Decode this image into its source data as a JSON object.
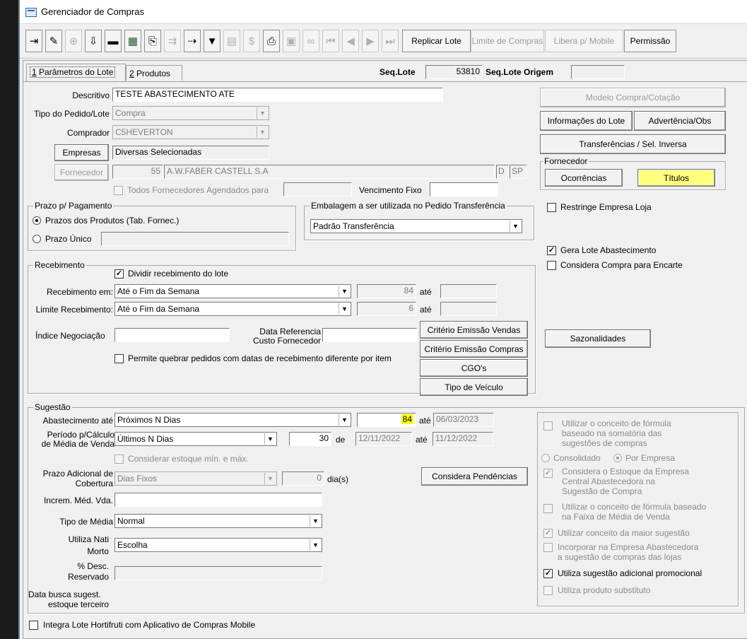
{
  "window": {
    "title": "Gerenciador de Compras"
  },
  "toolbar": {
    "icons": [
      "exit-icon",
      "edit-icon",
      "add-icon",
      "download-icon",
      "delete-icon",
      "grid-icon",
      "copy-icon",
      "transfer-icon",
      "next-step-icon",
      "filter-icon",
      "print-preview-icon",
      "money-icon",
      "print-icon",
      "clipboard-icon",
      "binoculars-icon",
      "first-record-icon",
      "previous-record-icon",
      "next-record-icon",
      "last-record-icon"
    ],
    "replicar_lote": "Replicar Lote",
    "limite_compras": "Limite de Compras",
    "libera_mobile": "Libera p/ Mobile",
    "permissao": "Permissão"
  },
  "tabs": {
    "tab1_num": "1",
    "tab1_label": "Parâmetros do Lote",
    "tab2_num": "2",
    "tab2_label": "Produtos"
  },
  "header": {
    "seq_lote_label": "Seq.Lote",
    "seq_lote_value": "53810",
    "seq_lote_origem_label": "Seq.Lote Origem",
    "seq_lote_origem_value": ""
  },
  "main": {
    "descritivo_label": "Descritivo",
    "descritivo_value": "TESTE ABASTECIMENTO ATE",
    "tipo_pedido_label": "Tipo do Pedido/Lote",
    "tipo_pedido_value": "Compra",
    "comprador_label": "Comprador",
    "comprador_value": "C5HEVERTON",
    "empresas_button": "Empresas",
    "empresas_value": "Diversas Selecionadas",
    "fornecedor_button": "Fornecedor",
    "fornecedor_code": "55",
    "fornecedor_name": "A.W.FABER CASTELL S.A",
    "fornecedor_flag": "D",
    "fornecedor_uf": "SP",
    "todos_fornecedores_label": "Todos Fornecedores Agendados para",
    "vencimento_fixo_label": "Vencimento Fixo",
    "vencimento_fixo_value": ""
  },
  "prazo": {
    "title": "Prazo p/ Pagamento",
    "opt1": "Prazos dos Produtos (Tab. Fornec.)",
    "opt2": "Prazo Único",
    "prazo_unico_value": ""
  },
  "embalagem": {
    "title": "Embalagem a ser utilizada no Pedido Transferência",
    "value": "Padrão Transferência"
  },
  "recebimento": {
    "title": "Recebimento",
    "dividir_label": "Dividir recebimento do lote",
    "receb_em_label": "Recebimento em:",
    "receb_em_value": "Até o Fim da Semana",
    "receb_em_num": "84",
    "ate1": "até",
    "receb_em_ate": "",
    "limite_label": "Limite Recebimento:",
    "limite_value": "Até o Fim da Semana",
    "limite_num": "6",
    "ate2": "até",
    "limite_ate": "",
    "indice_label": "Índice Negociação",
    "indice_value": "",
    "data_ref_label1": "Data Referencia",
    "data_ref_label2": "Custo Fornecedor",
    "data_ref_value": "",
    "permite_label": "Permite quebrar pedidos com datas de recebimento diferente por item",
    "criterio_vendas": "Critério Emissão Vendas",
    "criterio_compras": "Critério Emissão Compras",
    "cgo": "CGO's",
    "tipo_veiculo": "Tipo de Veículo"
  },
  "sugestao": {
    "title": "Sugestão",
    "abast_label": "Abastecimento até",
    "abast_value": "Próximos N Dias",
    "abast_num": "84",
    "abast_ate": "até",
    "abast_date": "06/03/2023",
    "periodo_label1": "Período p/Cálculo",
    "periodo_label2": "de Média de Venda",
    "periodo_value": "Últimos N Dias",
    "periodo_num": "30",
    "periodo_de": "de",
    "periodo_date1": "12/11/2022",
    "periodo_ate": "até",
    "periodo_date2": "11/12/2022",
    "considerar_estoque_label": "Considerar estoque mín. e máx.",
    "prazo_adic_label1": "Prazo Adicional de",
    "prazo_adic_label2": "Cobertura",
    "prazo_adic_value": "Dias Fixos",
    "prazo_adic_num": "0",
    "dias_label": "dia(s)",
    "considera_pendencias": "Considera Pendências",
    "increm_label": "Increm. Méd. Vda.",
    "increm_value": "",
    "tipo_media_label": "Tipo de Média",
    "tipo_media_value": "Normal",
    "utiliza_nati_label1": "Utiliza Nati",
    "utiliza_nati_label2": "Morto",
    "utiliza_nati_value": "Escolha",
    "desc_reservado_label1": "% Desc.",
    "desc_reservado_label2": "Reservado",
    "desc_reservado_value": "",
    "data_busca_label1": "Data busca sugest.",
    "data_busca_label2": "estoque terceiro"
  },
  "right": {
    "modelo_compra": "Modelo Compra/Cotação",
    "info_lote": "Informações do Lote",
    "advertencia": "Advertência/Obs",
    "transferencias": "Transferências / Sel. Inversa",
    "fornecedor_title": "Fornecedor",
    "ocorrencias": "Ocorrências",
    "titulos": "Títulos",
    "restringe_label": "Restringe Empresa Loja",
    "gera_lote_label": "Gera Lote Abastecimento",
    "considera_compra_label": "Considera Compra para Encarte",
    "sazonalidades": "Sazonalidades",
    "util_formula_1": "Utilizar o conceito de fórmula",
    "util_formula_2": "baseado na somatória das",
    "util_formula_3": "sugestões de compras",
    "consolidado": "Consolidado",
    "por_empresa": "Por Empresa",
    "considera_estoque_1": "Considera o Estoque da Empresa",
    "considera_estoque_2": "Central Abastecedora na",
    "considera_estoque_3": "Sugestão de Compra",
    "util_faixa_1": "Utilizar o conceito de fórmula baseado",
    "util_faixa_2": "na Faixa de Média de Venda",
    "maior_sugestao": "Utilizar conceito da maior sugestão",
    "incorporar_1": "Incorporar na Empresa Abastecedora",
    "incorporar_2": "a sugestão de compras das lojas",
    "adicional_promocional": "Utiliza sugestão adicional promocional",
    "produto_substituto": "Utiliza produto substituto"
  },
  "footer": {
    "integra_label": "Integra Lote Hortifruti com Aplicativo de Compras Mobile"
  },
  "colors": {
    "highlight": "#ffff66",
    "titulos_bg": "#ffff80"
  }
}
